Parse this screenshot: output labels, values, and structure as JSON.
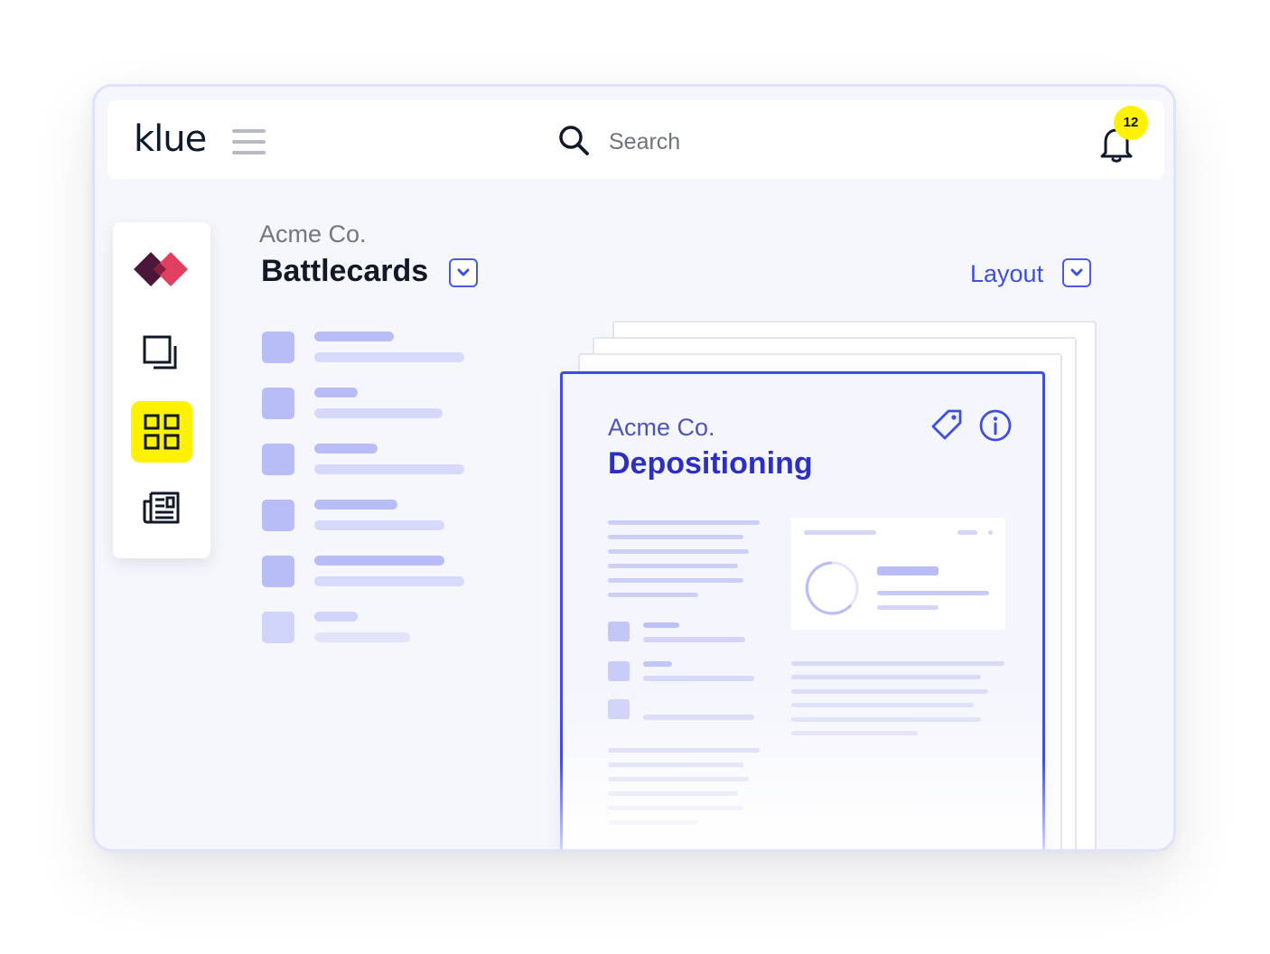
{
  "header": {
    "logo": "klue",
    "search_placeholder": "Search",
    "notification_count": "12"
  },
  "sidebar": {
    "items": [
      {
        "name": "brand-logo"
      },
      {
        "name": "cards"
      },
      {
        "name": "battlecards",
        "active": true
      },
      {
        "name": "news"
      }
    ]
  },
  "main": {
    "breadcrumb": "Acme Co.",
    "title": "Battlecards",
    "layout_label": "Layout"
  },
  "card": {
    "company": "Acme Co.",
    "title": "Depositioning"
  },
  "colors": {
    "accent": "#3d4ee0",
    "highlight": "#fff200",
    "placeholder": "#b9bdf7"
  }
}
